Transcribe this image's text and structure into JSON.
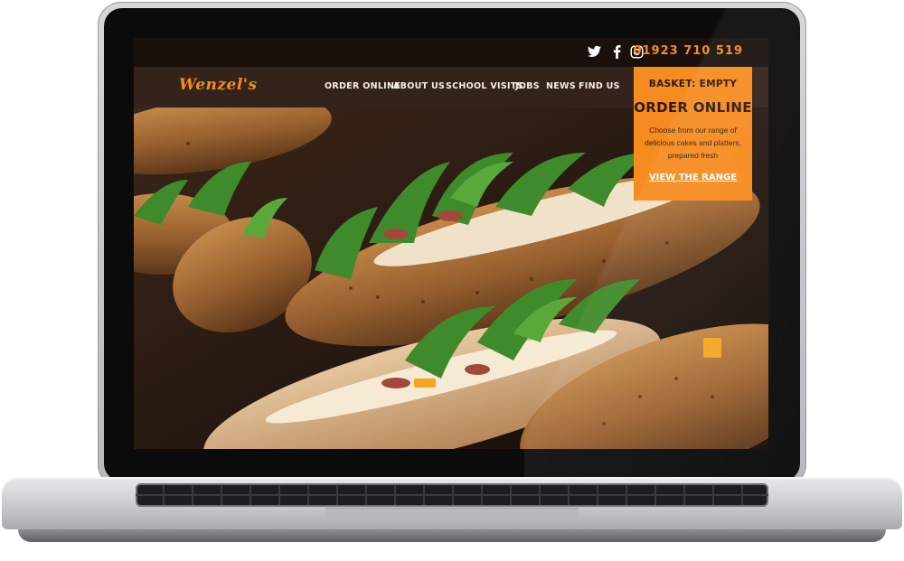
{
  "site": {
    "logo_text": "Wenzel's",
    "phone": "01923 710 519",
    "social": [
      {
        "name": "twitter-icon"
      },
      {
        "name": "facebook-icon"
      },
      {
        "name": "instagram-icon"
      }
    ]
  },
  "nav": {
    "items": [
      {
        "label": "ORDER ONLINE"
      },
      {
        "label": "ABOUT US"
      },
      {
        "label": "SCHOOL VISITS"
      },
      {
        "label": "JOBS"
      },
      {
        "label": "NEWS"
      },
      {
        "label": "FIND US"
      }
    ]
  },
  "order_panel": {
    "basket": "BASKET: EMPTY",
    "title": "ORDER ONLINE",
    "description": "Choose from our range of delicious cakes and platters, prepared fresh",
    "link": "VIEW THE RANGE"
  },
  "colors": {
    "accent": "#f68b1f",
    "topbar": "#1a110d",
    "navbar": "#34231a"
  }
}
